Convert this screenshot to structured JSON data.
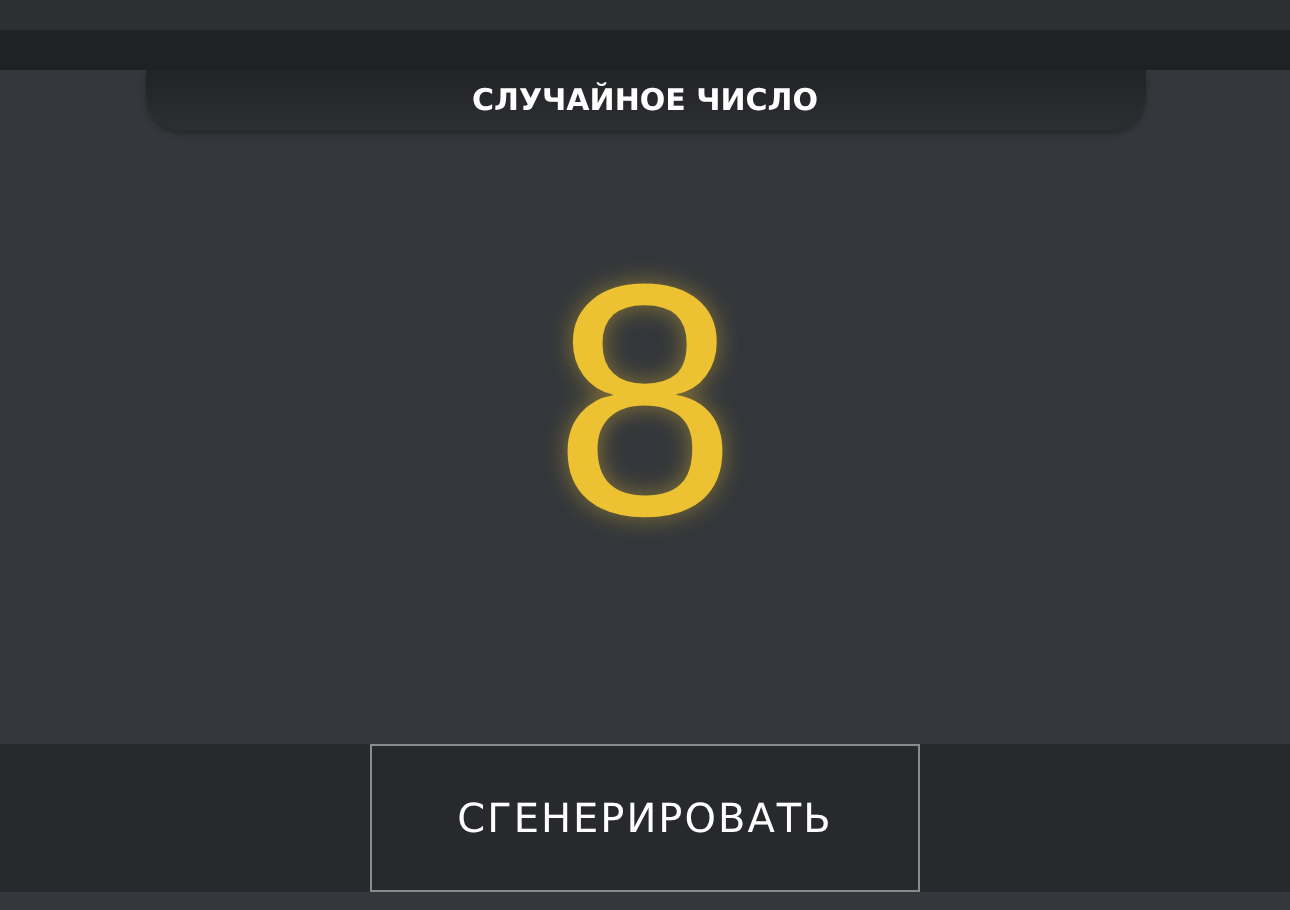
{
  "header": {
    "title": "СЛУЧАЙНОЕ ЧИСЛО"
  },
  "result": {
    "value": "8"
  },
  "buttons": [
    {
      "label": "СГЕНЕРИРОВАТЬ"
    }
  ]
}
